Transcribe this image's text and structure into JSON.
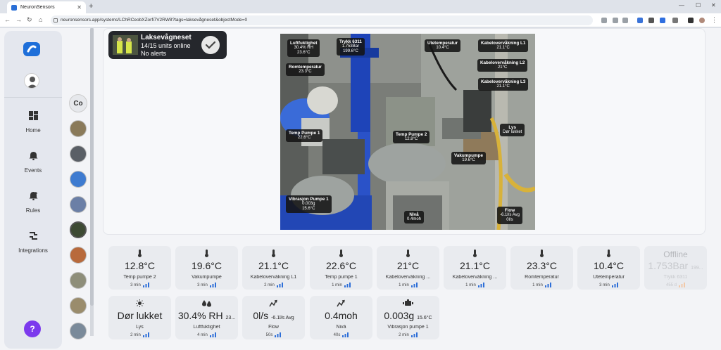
{
  "browser": {
    "tab_title": "NeuronSensors",
    "url": "neuronsensors.app/systems/LChRCeobXZorfi7V2RW8?tags=laksevågneset&objectMode=0"
  },
  "sidebar": {
    "nav": [
      {
        "label": "Home",
        "icon": "dashboard-icon"
      },
      {
        "label": "Events",
        "icon": "bell-icon"
      },
      {
        "label": "Rules",
        "icon": "bell-plus-icon"
      },
      {
        "label": "Integrations",
        "icon": "integrations-icon"
      }
    ],
    "help_label": "?",
    "company_initials": "Co"
  },
  "system": {
    "name": "Laksevågneset",
    "units": "14/15 units online",
    "alerts": "No alerts"
  },
  "photo_tags": [
    {
      "name": "Luftfuktighet",
      "lines": [
        "30.4% RH",
        "23.6°C"
      ]
    },
    {
      "name": "Trykk 6311",
      "lines": [
        "1.753Bar",
        "199.6°C"
      ]
    },
    {
      "name": "Utetemperatur",
      "lines": [
        "10.4°C"
      ]
    },
    {
      "name": "Kabelovervåkning L1",
      "lines": [
        "21.1°C"
      ]
    },
    {
      "name": "Romtemperatur",
      "lines": [
        "23.3°C"
      ]
    },
    {
      "name": "Kabelovervåkning L2",
      "lines": [
        "21°C"
      ]
    },
    {
      "name": "Kabelovervåkning L3",
      "lines": [
        "21.1°C"
      ]
    },
    {
      "name": "Lys",
      "lines": [
        "Dør lukket"
      ]
    },
    {
      "name": "Temp Pumpe 1",
      "lines": [
        "22.6°C"
      ]
    },
    {
      "name": "Temp Pumpe 2",
      "lines": [
        "12.8°C"
      ]
    },
    {
      "name": "Vakumpumpe",
      "lines": [
        "19.6°C"
      ]
    },
    {
      "name": "Vibrasjon Pumpe 1",
      "lines": [
        "0.003g",
        "15.6°C"
      ]
    },
    {
      "name": "Nivå",
      "lines": [
        "0.4moh"
      ]
    },
    {
      "name": "Flow",
      "lines": [
        "-6.1l/s Avg",
        "0l/s"
      ]
    }
  ],
  "cards_row1": [
    {
      "value": "12.8°C",
      "name": "Temp pumpe 2",
      "time": "3 min",
      "icon": "thermometer-icon"
    },
    {
      "value": "19.6°C",
      "name": "Vakumpumpe",
      "time": "3 min",
      "icon": "thermometer-icon"
    },
    {
      "value": "21.1°C",
      "name": "Kabelovervåkning L1",
      "time": "2 min",
      "icon": "thermometer-icon"
    },
    {
      "value": "22.6°C",
      "name": "Temp pumpe 1",
      "time": "1 min",
      "icon": "thermometer-icon"
    },
    {
      "value": "21°C",
      "name": "Kabelovervåkning ...",
      "time": "1 min",
      "icon": "thermometer-icon"
    },
    {
      "value": "21.1°C",
      "name": "Kabelovervåkning ...",
      "time": "1 min",
      "icon": "thermometer-icon"
    },
    {
      "value": "23.3°C",
      "name": "Romtemperatur",
      "time": "1 min",
      "icon": "thermometer-icon"
    },
    {
      "value": "10.4°C",
      "name": "Utetemperatur",
      "time": "3 min",
      "icon": "thermometer-icon"
    }
  ],
  "offline_card": {
    "title": "Offline",
    "value": "1.753Bar",
    "sub": "199...",
    "name": "Trykk 6311",
    "time": "455 d"
  },
  "cards_row2": [
    {
      "value": "Dør lukket",
      "sub": "",
      "name": "Lys",
      "time": "2 min",
      "icon": "light-icon"
    },
    {
      "value": "30.4% RH",
      "sub": "23...",
      "name": "Luftfuktighet",
      "time": "4 min",
      "icon": "humidity-icon"
    },
    {
      "value": "0l/s",
      "sub": "-6.1l/s Avg",
      "name": "Flow",
      "time": "50s",
      "icon": "flow-icon"
    },
    {
      "value": "0.4moh",
      "sub": "",
      "name": "Nivå",
      "time": "40s",
      "icon": "level-icon"
    },
    {
      "value": "0.003g",
      "sub": "15.6°C",
      "name": "Vibrasjon pumpe 1",
      "time": "2 min",
      "icon": "vibration-icon"
    }
  ]
}
